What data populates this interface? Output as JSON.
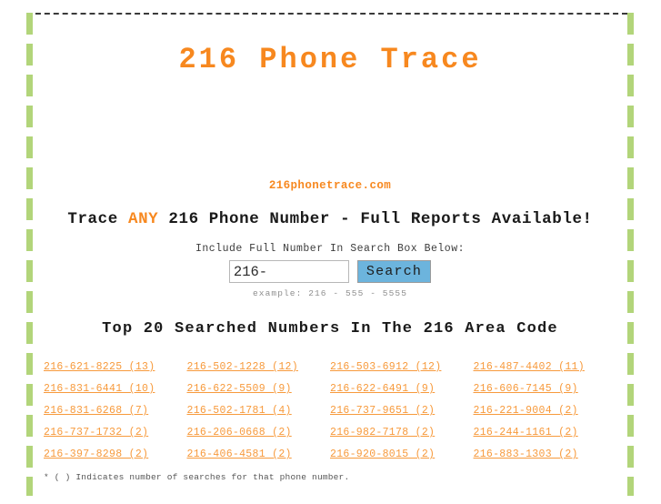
{
  "header": {
    "title": "216 Phone Trace",
    "title_color": "#f7881f"
  },
  "site": {
    "url": "216phonetrace.com"
  },
  "tagline": {
    "before": "Trace ",
    "highlight": "ANY",
    "after": " 216 Phone Number - Full Reports Available!"
  },
  "search": {
    "label": "Include Full Number In Search Box Below:",
    "input_value": "216-",
    "input_placeholder": "216-",
    "button_label": "Search",
    "button_color": "#6cb4dd",
    "example": "example: 216 - 555 - 5555"
  },
  "top_numbers": {
    "heading": "Top 20 Searched Numbers In The 216 Area Code",
    "link_color": "#f79a3c",
    "items": [
      "216-621-8225 (13)",
      "216-502-1228 (12)",
      "216-503-6912 (12)",
      "216-487-4402 (11)",
      "216-831-6441 (10)",
      "216-622-5509 (9)",
      "216-622-6491 (9)",
      "216-606-7145 (9)",
      "216-831-6268 (7)",
      "216-502-1781 (4)",
      "216-737-9651 (2)",
      "216-221-9004 (2)",
      "216-737-1732 (2)",
      "216-206-0668 (2)",
      "216-982-7178 (2)",
      "216-244-1161 (2)",
      "216-397-8298 (2)",
      "216-406-4581 (2)",
      "216-920-8015 (2)",
      "216-883-1303 (2)"
    ]
  },
  "footer": {
    "note": "* ( ) Indicates number of searches for that phone number."
  },
  "frame": {
    "rail_color": "#b2d57a",
    "top_border_color": "#3a3a3a"
  }
}
